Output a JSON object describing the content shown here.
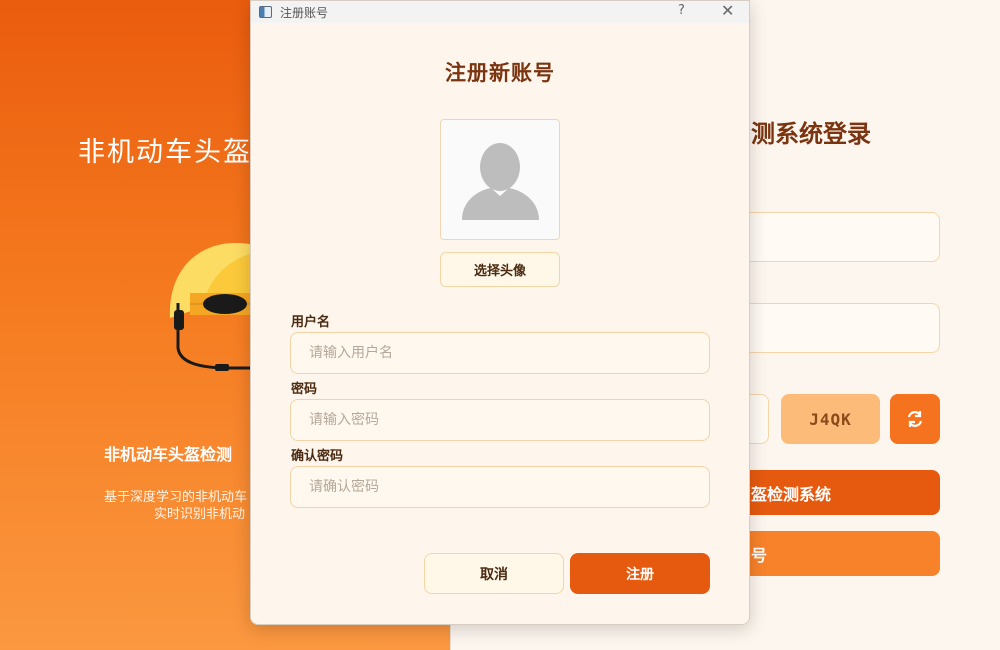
{
  "background_window": {
    "hero_title": "非机动车头盔",
    "subtitle": "非机动车头盔检测",
    "description_line1": "基于深度学习的非机动车",
    "description_line2": "实时识别非机动",
    "login_title": "测系统登录",
    "captcha_text": "J4QK",
    "login_button_label": "盔检测系统",
    "register_button_label": "号"
  },
  "dialog": {
    "window_title": "注册账号",
    "help_glyph": "?",
    "close_glyph": "✕",
    "heading": "注册新账号",
    "choose_avatar_label": "选择头像",
    "fields": {
      "username": {
        "label": "用户名",
        "placeholder": "请输入用户名"
      },
      "password": {
        "label": "密码",
        "placeholder": "请输入密码"
      },
      "confirm": {
        "label": "确认密码",
        "placeholder": "请确认密码"
      }
    },
    "cancel_label": "取消",
    "register_label": "注册"
  },
  "colors": {
    "accent": "#e65a0f",
    "accent_light": "#f8822a",
    "heading_brown": "#7a3410",
    "captcha_bg": "#fdbb7a"
  },
  "icons": {
    "helmet": "helmet-icon",
    "refresh": "refresh-icon",
    "avatar": "avatar-placeholder-icon"
  }
}
